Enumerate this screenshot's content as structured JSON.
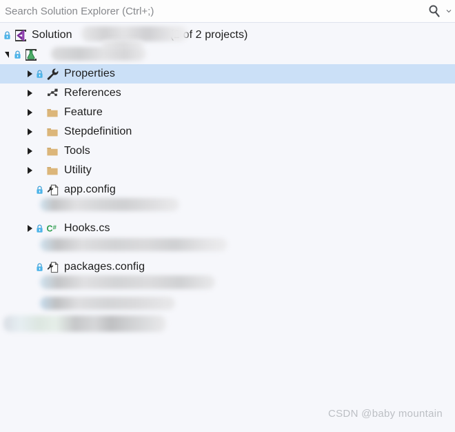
{
  "search": {
    "placeholder": "Search Solution Explorer (Ctrl+;)",
    "value": "",
    "magnifier_icon": "search-icon",
    "dropdown_icon": "chevron-down-icon"
  },
  "tree": {
    "solution": {
      "label": "Solution",
      "suffix": "(2 of 2 projects)",
      "icon": "visual-studio-solution-icon",
      "lock_icon": "lock-icon",
      "redacted_name": true
    },
    "project": {
      "label": "",
      "icon": "test-project-flask-icon",
      "lock_icon": "lock-icon",
      "expanded": true,
      "redacted_name": true
    },
    "items": [
      {
        "label": "Properties",
        "icon": "wrench-icon",
        "locked": true,
        "expandable": true,
        "selected": true,
        "indent": 1
      },
      {
        "label": "References",
        "icon": "references-icon",
        "locked": false,
        "expandable": true,
        "selected": false,
        "indent": 1
      },
      {
        "label": "Feature",
        "icon": "folder-icon",
        "locked": false,
        "expandable": true,
        "selected": false,
        "indent": 1
      },
      {
        "label": "Stepdefinition",
        "icon": "folder-icon",
        "locked": false,
        "expandable": true,
        "selected": false,
        "indent": 1
      },
      {
        "label": "Tools",
        "icon": "folder-icon",
        "locked": false,
        "expandable": true,
        "selected": false,
        "indent": 1
      },
      {
        "label": "Utility",
        "icon": "folder-icon",
        "locked": false,
        "expandable": true,
        "selected": false,
        "indent": 1
      },
      {
        "label": "app.config",
        "icon": "config-file-icon",
        "locked": true,
        "expandable": false,
        "selected": false,
        "indent": 1
      },
      {
        "label": "",
        "icon": "redacted",
        "locked": false,
        "expandable": false,
        "selected": false,
        "indent": 1,
        "redacted": true
      },
      {
        "label": "Hooks.cs",
        "icon": "csharp-file-icon",
        "locked": true,
        "expandable": true,
        "selected": false,
        "indent": 1
      },
      {
        "label": "",
        "icon": "redacted",
        "locked": false,
        "expandable": false,
        "selected": false,
        "indent": 1,
        "redacted": true
      },
      {
        "label": "packages.config",
        "icon": "config-file-icon",
        "locked": true,
        "expandable": false,
        "selected": false,
        "indent": 1
      },
      {
        "label": "",
        "icon": "redacted",
        "locked": false,
        "expandable": false,
        "selected": false,
        "indent": 1,
        "redacted": true
      },
      {
        "label": "",
        "icon": "redacted",
        "locked": false,
        "expandable": false,
        "selected": false,
        "indent": 1,
        "redacted": true
      },
      {
        "label": "",
        "icon": "redacted",
        "locked": false,
        "expandable": false,
        "selected": false,
        "indent": 0,
        "redacted": true
      }
    ]
  },
  "watermark": "CSDN @baby mountain",
  "colors": {
    "background": "#f6f7fb",
    "selection": "#cbe0f7",
    "folder": "#dcb67a",
    "csharp_green": "#2e9e4f",
    "lock_blue": "#3f9fd6",
    "flask_green": "#2f9e53",
    "solution_purple": "#68217a",
    "text": "#1c1c1c",
    "placeholder": "#86888c"
  }
}
